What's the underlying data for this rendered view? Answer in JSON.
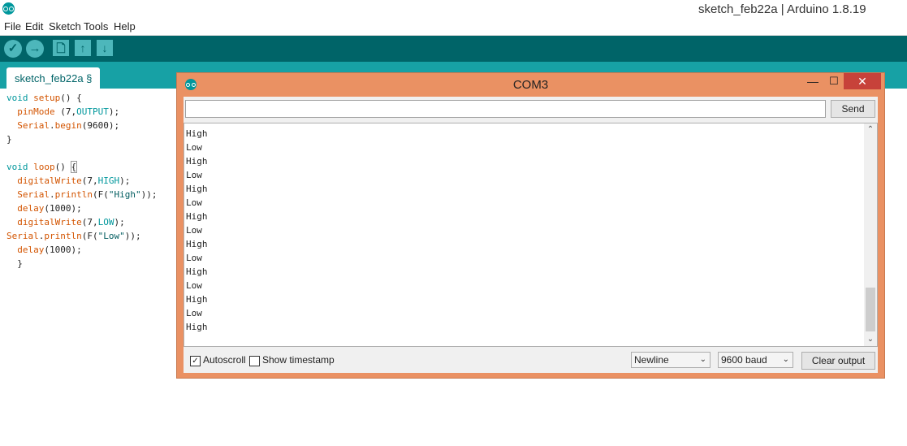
{
  "window": {
    "title": "sketch_feb22a | Arduino 1.8.19"
  },
  "menu": [
    "File",
    "Edit",
    "Sketch",
    "Tools",
    "Help"
  ],
  "toolbar": {
    "verify": "✓",
    "upload": "→",
    "new": "🗋",
    "open": "↑",
    "save": "↓"
  },
  "tab": {
    "label": "sketch_feb22a §"
  },
  "serial_monitor": {
    "title": "COM3",
    "minimize": "—",
    "maximize": "☐",
    "close": "✕",
    "input_value": "",
    "send_label": "Send",
    "output_lines": [
      "High",
      "Low",
      "High",
      "Low",
      "High",
      "Low",
      "High",
      "Low",
      "High",
      "Low",
      "High",
      "Low",
      "High",
      "Low",
      "High"
    ],
    "autoscroll_label": "Autoscroll",
    "autoscroll_checked": true,
    "timestamp_label": "Show timestamp",
    "timestamp_checked": false,
    "line_ending": "Newline",
    "baud": "9600 baud",
    "clear_label": "Clear output",
    "scroll_up": "⌃",
    "scroll_down": "⌄",
    "dropdown_arrow": "⌄"
  },
  "colors": {
    "toolbar": "#006468",
    "tabbar": "#17a1a5",
    "serial_frame": "#ea9163",
    "close_button": "#c7423a"
  }
}
